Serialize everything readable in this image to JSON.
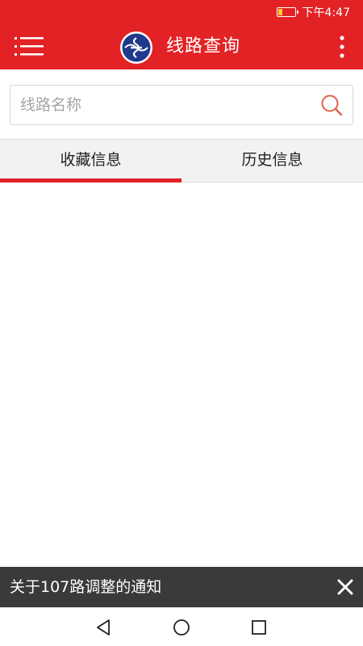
{
  "status_bar": {
    "time": "下午4:47",
    "battery_icon": "battery-low-icon"
  },
  "app_bar": {
    "title": "线路查询",
    "menu_icon": "menu-icon",
    "logo_icon": "bus-company-logo",
    "more_icon": "more-vertical-icon",
    "color": "#e32225"
  },
  "search": {
    "placeholder": "线路名称",
    "value": "",
    "icon": "search-icon"
  },
  "tabs": [
    {
      "label": "收藏信息",
      "active": true
    },
    {
      "label": "历史信息",
      "active": false
    }
  ],
  "notice": {
    "text": "关于107路调整的通知",
    "close_icon": "close-icon"
  },
  "nav_bar": {
    "back_icon": "back-triangle-icon",
    "home_icon": "home-circle-icon",
    "recent_icon": "recent-apps-square-icon"
  }
}
